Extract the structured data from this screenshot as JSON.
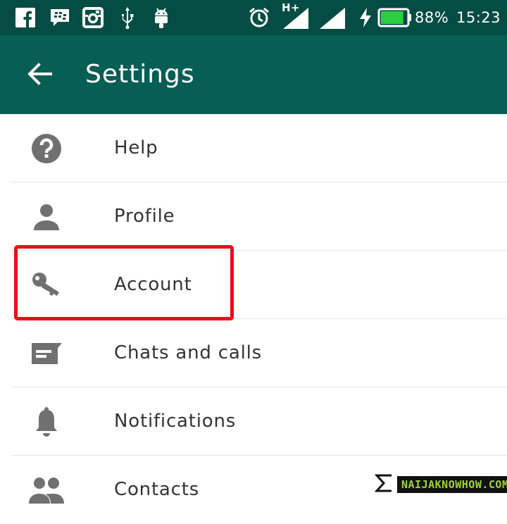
{
  "status_bar": {
    "left_icons": [
      "facebook-icon",
      "bbm-icon",
      "instagram-icon",
      "usb-icon",
      "android-icon"
    ],
    "right_icons": [
      "alarm-icon",
      "signal-hplus-icon",
      "signal-icon",
      "charging-icon",
      "battery-icon"
    ],
    "network_label": "H+",
    "battery_percent": "88%",
    "battery_level": 0.88,
    "time": "15:23",
    "battery_color": "#2ecc40"
  },
  "app_bar": {
    "back_icon": "arrow-back-icon",
    "title": "Settings",
    "color": "#075e54"
  },
  "settings_items": [
    {
      "label": "Help",
      "icon": "help-icon"
    },
    {
      "label": "Profile",
      "icon": "profile-icon"
    },
    {
      "label": "Account",
      "icon": "key-icon"
    },
    {
      "label": "Chats and calls",
      "icon": "chat-icon"
    },
    {
      "label": "Notifications",
      "icon": "bell-icon"
    },
    {
      "label": "Contacts",
      "icon": "contacts-icon"
    }
  ],
  "highlight": {
    "target": "Account",
    "color": "#ee0c17"
  },
  "watermark": {
    "text": "NAIJAKNOWHOW.COM"
  }
}
